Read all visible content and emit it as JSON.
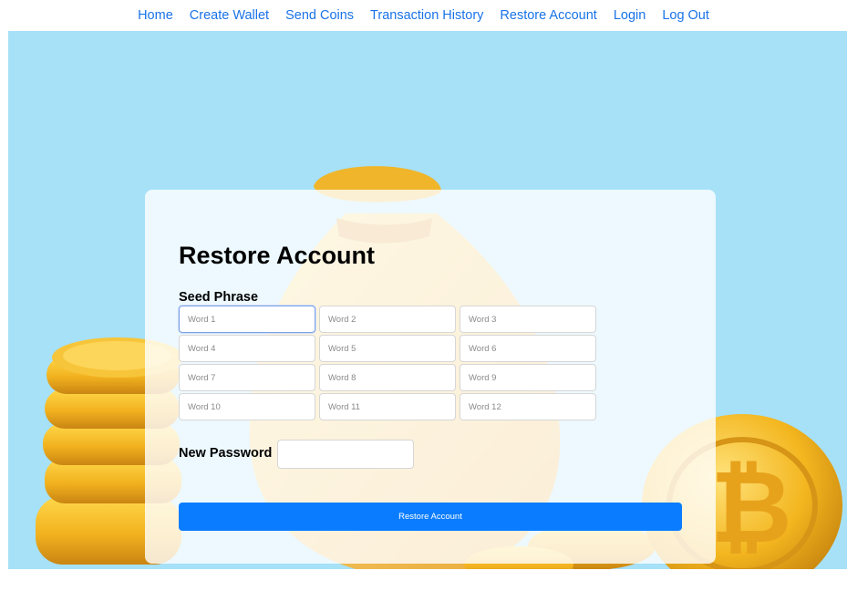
{
  "nav": {
    "items": [
      {
        "label": "Home"
      },
      {
        "label": "Create Wallet"
      },
      {
        "label": "Send Coins"
      },
      {
        "label": "Transaction History"
      },
      {
        "label": "Restore Account"
      },
      {
        "label": "Login"
      },
      {
        "label": "Log Out"
      }
    ],
    "color": "#1a73e8"
  },
  "colors": {
    "background": "#a6e1f7",
    "coin_gold": "#f2b21f",
    "button": "#0a7cff"
  },
  "form": {
    "title": "Restore Account",
    "seed_label": "Seed Phrase",
    "seed_words": [
      {
        "placeholder": "Word 1",
        "value": ""
      },
      {
        "placeholder": "Word 2",
        "value": ""
      },
      {
        "placeholder": "Word 3",
        "value": ""
      },
      {
        "placeholder": "Word 4",
        "value": ""
      },
      {
        "placeholder": "Word 5",
        "value": ""
      },
      {
        "placeholder": "Word 6",
        "value": ""
      },
      {
        "placeholder": "Word 7",
        "value": ""
      },
      {
        "placeholder": "Word 8",
        "value": ""
      },
      {
        "placeholder": "Word 9",
        "value": ""
      },
      {
        "placeholder": "Word 10",
        "value": ""
      },
      {
        "placeholder": "Word 11",
        "value": ""
      },
      {
        "placeholder": "Word 12",
        "value": ""
      }
    ],
    "password_label": "New Password",
    "password_value": "",
    "submit_label": "Restore Account"
  },
  "background_image": {
    "icons": [
      "money-bag-icon",
      "coin-stack-icon",
      "bitcoin-coin-icon"
    ]
  }
}
